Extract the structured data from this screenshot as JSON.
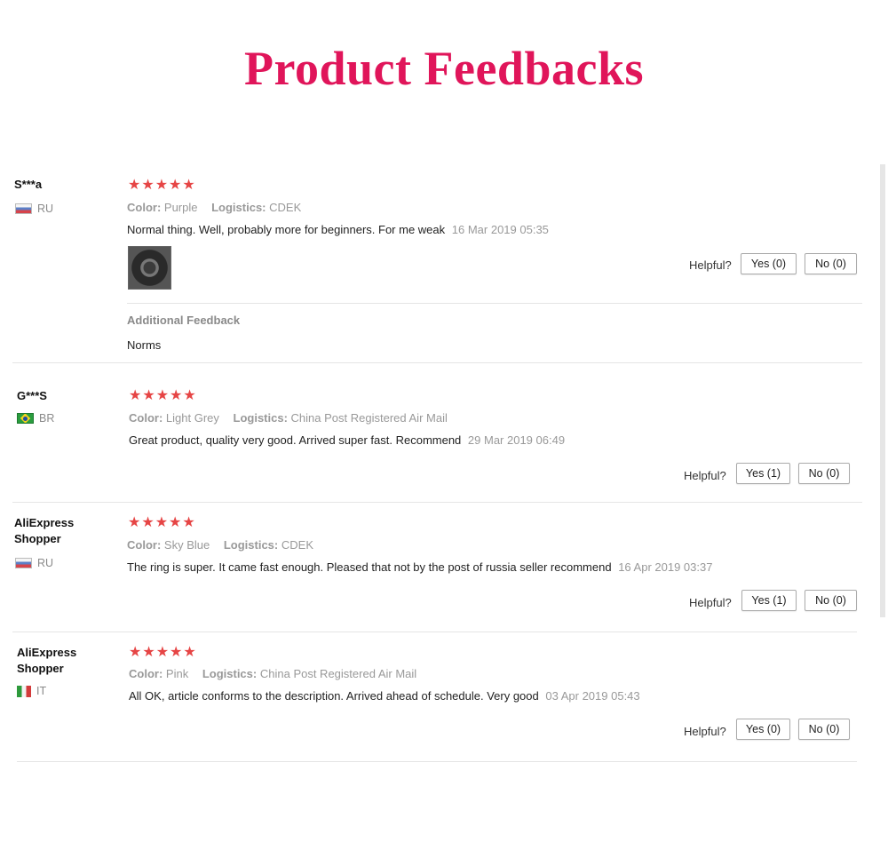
{
  "page": {
    "title": "Product Feedbacks",
    "title_color": "#e0155a"
  },
  "ui": {
    "helpful_label": "Helpful?",
    "color_label": "Color:",
    "logistics_label": "Logistics:",
    "star_color": "#e64545",
    "rating_stars": "★★★★★"
  },
  "reviews": [
    {
      "user": "S***a",
      "country": "RU",
      "rating": 5,
      "color": "Purple",
      "logistics": "CDEK",
      "text": "Normal thing. Well, probably more for beginners. For me weak",
      "date": "16 Mar 2019 05:35",
      "yes": "Yes (0)",
      "no": "No (0)",
      "has_photo": true,
      "additional_title": "Additional Feedback",
      "additional_text": "Norms"
    },
    {
      "user": "G***S",
      "country": "BR",
      "rating": 5,
      "color": "Light Grey",
      "logistics": "China Post Registered Air Mail",
      "text": "Great product, quality very good. Arrived super fast. Recommend",
      "date": "29 Mar 2019 06:49",
      "yes": "Yes (1)",
      "no": "No (0)"
    },
    {
      "user": "AliExpress Shopper",
      "country": "RU",
      "rating": 5,
      "color": "Sky Blue",
      "logistics": "CDEK",
      "text": "The ring is super. It came fast enough. Pleased that not by the post of russia seller recommend",
      "date": "16 Apr 2019 03:37",
      "yes": "Yes (1)",
      "no": "No (0)"
    },
    {
      "user": "AliExpress Shopper",
      "country": "IT",
      "rating": 5,
      "color": "Pink",
      "logistics": "China Post Registered Air Mail",
      "text": "All OK, article conforms to the description. Arrived ahead of schedule. Very good",
      "date": "03 Apr 2019 05:43",
      "yes": "Yes (0)",
      "no": "No (0)"
    }
  ]
}
